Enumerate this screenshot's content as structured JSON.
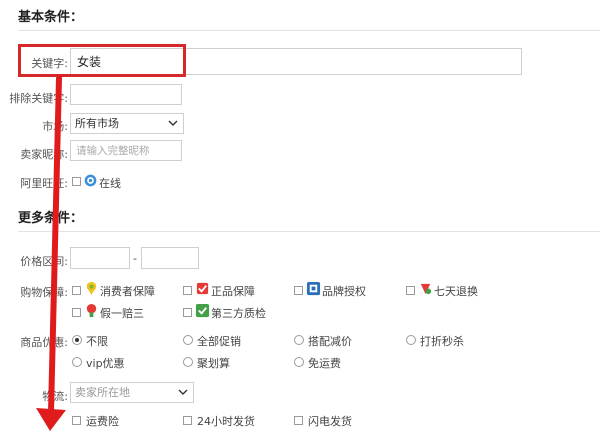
{
  "basic": {
    "title": "基本条件：",
    "keyword_label": "关键字:",
    "keyword_value": "女装",
    "exclude_label": "排除关键字:",
    "market_label": "市场:",
    "market_value": "所有市场",
    "seller_label": "卖家昵称:",
    "seller_placeholder": "请输入完整昵称",
    "wangwang_label": "阿里旺旺:",
    "wangwang_option": "在线"
  },
  "more": {
    "title": "更多条件：",
    "price_label": "价格区间:",
    "price_dash": "-",
    "shopping_label": "购物保障:",
    "shopping_options": [
      "消费者保障",
      "正品保障",
      "品牌授权",
      "七天退换",
      "假一赔三",
      "第三方质检"
    ],
    "discount_label": "商品优惠:",
    "discount_options": [
      "不限",
      "全部促销",
      "搭配减价",
      "打折秒杀",
      "vip优惠",
      "聚划算",
      "免运费"
    ],
    "location_label": "物流:",
    "location_value": "卖家所在地",
    "shipping_options": [
      "运费险",
      "24小时发货",
      "闪电发货"
    ]
  },
  "colors": {
    "highlight": "#d62828",
    "arrow": "#e01b1b"
  }
}
